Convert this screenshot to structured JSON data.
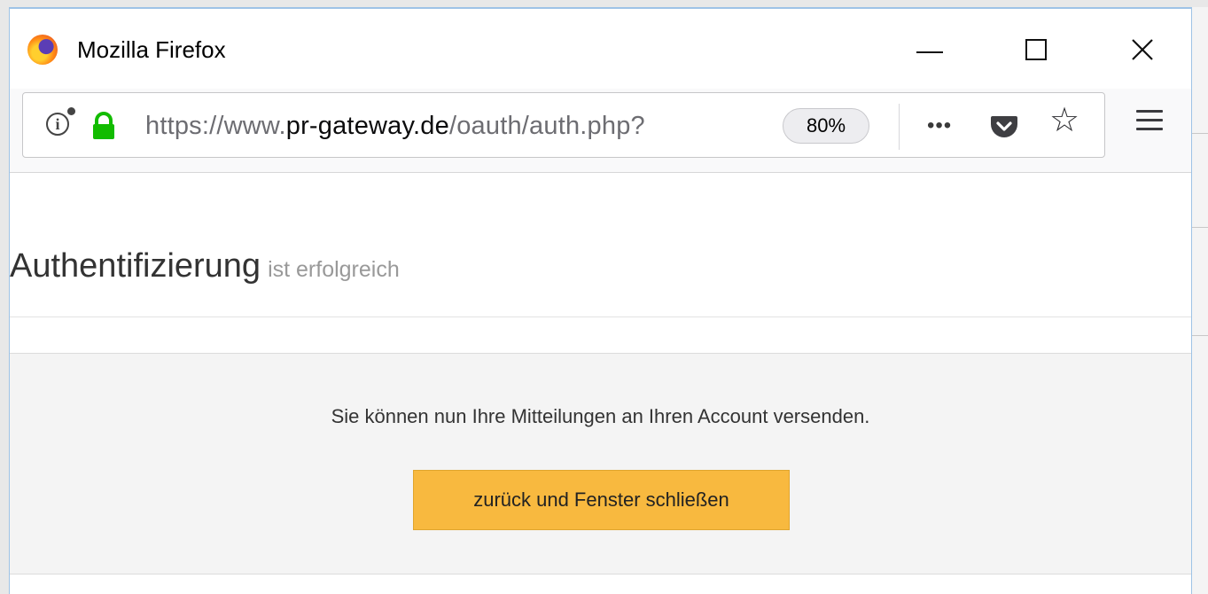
{
  "window": {
    "title": "Mozilla Firefox",
    "icons": {
      "app": "firefox-logo",
      "minimize": "minimize-icon",
      "maximize": "maximize-icon",
      "close": "close-icon"
    },
    "close_glyph": "✕"
  },
  "toolbar": {
    "url": {
      "prefix": "https://www.",
      "host": "pr-gateway.de",
      "path": "/oauth/auth.php?"
    },
    "zoom": "80%",
    "more_glyph": "•••",
    "star_glyph": "☆",
    "info_glyph": "i",
    "secure_color": "#12bc00",
    "pocket_color": "#3e3e42"
  },
  "page": {
    "heading": "Authentifizierung",
    "subheading": "ist erfolgreich",
    "message": "Sie können nun Ihre Mitteilungen an Ihren Account versenden.",
    "button_label": "zurück und Fenster schließen",
    "button_color": "#f8b93f",
    "panel_color": "#f4f4f4"
  }
}
